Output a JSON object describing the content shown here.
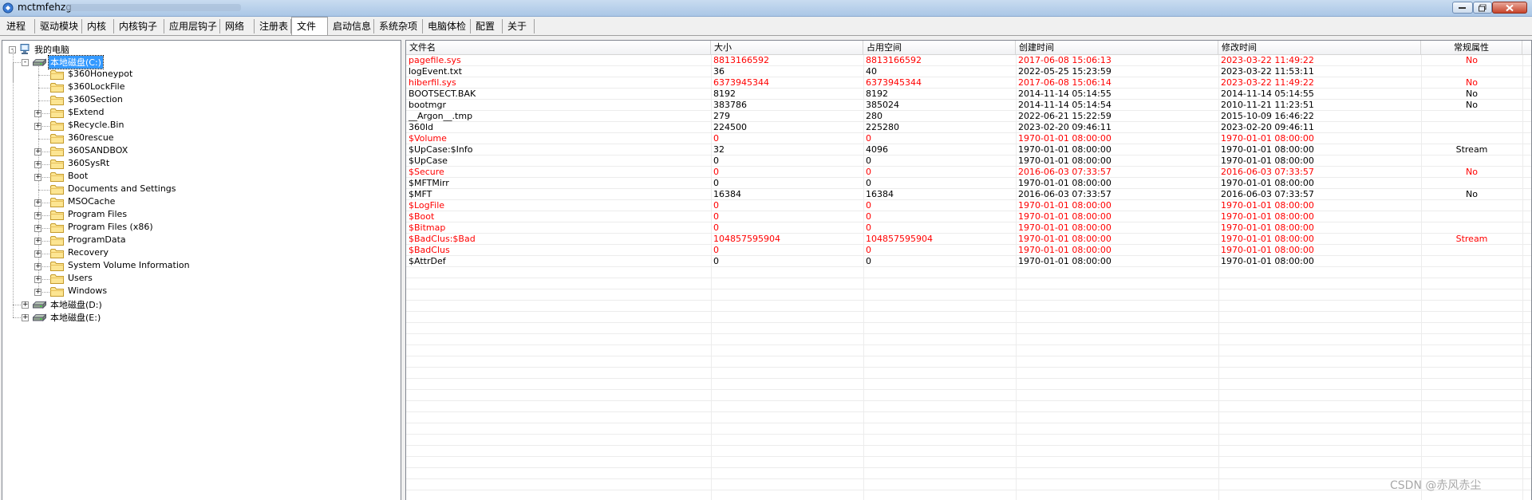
{
  "window": {
    "title": "mctmfehzg"
  },
  "tabs": [
    {
      "label": "进程"
    },
    {
      "label": "驱动模块"
    },
    {
      "label": "内核"
    },
    {
      "label": "内核钩子"
    },
    {
      "label": "应用层钩子"
    },
    {
      "label": "网络"
    },
    {
      "label": "注册表"
    },
    {
      "label": "文件",
      "active": true
    },
    {
      "label": "启动信息"
    },
    {
      "label": "系统杂项"
    },
    {
      "label": "电脑体检"
    },
    {
      "label": "配置"
    },
    {
      "label": "关于"
    }
  ],
  "tree": {
    "root": "我的电脑",
    "drive_c": "本地磁盘(C:)",
    "children": [
      {
        "label": "$360Honeypot",
        "expandable": false
      },
      {
        "label": "$360LockFile",
        "expandable": false
      },
      {
        "label": "$360Section",
        "expandable": false
      },
      {
        "label": "$Extend",
        "expandable": true
      },
      {
        "label": "$Recycle.Bin",
        "expandable": true
      },
      {
        "label": "360rescue",
        "expandable": false
      },
      {
        "label": "360SANDBOX",
        "expandable": true
      },
      {
        "label": "360SysRt",
        "expandable": true
      },
      {
        "label": "Boot",
        "expandable": true
      },
      {
        "label": "Documents and Settings",
        "expandable": false
      },
      {
        "label": "MSOCache",
        "expandable": true
      },
      {
        "label": "Program Files",
        "expandable": true
      },
      {
        "label": "Program Files (x86)",
        "expandable": true
      },
      {
        "label": "ProgramData",
        "expandable": true
      },
      {
        "label": "Recovery",
        "expandable": true
      },
      {
        "label": "System Volume Information",
        "expandable": true
      },
      {
        "label": "Users",
        "expandable": true
      },
      {
        "label": "Windows",
        "expandable": true
      }
    ],
    "other_drives": [
      "本地磁盘(D:)",
      "本地磁盘(E:)"
    ]
  },
  "list": {
    "columns": [
      "文件名",
      "大小",
      "占用空间",
      "创建时间",
      "修改时间",
      "常规属性"
    ],
    "rows": [
      {
        "name": "pagefile.sys",
        "size": "8813166592",
        "alloc": "8813166592",
        "created": "2017-06-08 15:06:13",
        "modified": "2023-03-22 11:49:22",
        "attr": "No",
        "red": true
      },
      {
        "name": "logEvent.txt",
        "size": "36",
        "alloc": "40",
        "created": "2022-05-25 15:23:59",
        "modified": "2023-03-22 11:53:11",
        "attr": "",
        "red": false
      },
      {
        "name": "hiberfil.sys",
        "size": "6373945344",
        "alloc": "6373945344",
        "created": "2017-06-08 15:06:14",
        "modified": "2023-03-22 11:49:22",
        "attr": "No",
        "red": true
      },
      {
        "name": "BOOTSECT.BAK",
        "size": "8192",
        "alloc": "8192",
        "created": "2014-11-14 05:14:55",
        "modified": "2014-11-14 05:14:55",
        "attr": "No",
        "red": false
      },
      {
        "name": "bootmgr",
        "size": "383786",
        "alloc": "385024",
        "created": "2014-11-14 05:14:54",
        "modified": "2010-11-21 11:23:51",
        "attr": "No",
        "red": false
      },
      {
        "name": "__Argon__.tmp",
        "size": "279",
        "alloc": "280",
        "created": "2022-06-21 15:22:59",
        "modified": "2015-10-09 16:46:22",
        "attr": "",
        "red": false
      },
      {
        "name": "360ld",
        "size": "224500",
        "alloc": "225280",
        "created": "2023-02-20 09:46:11",
        "modified": "2023-02-20 09:46:11",
        "attr": "",
        "red": false
      },
      {
        "name": "$Volume",
        "size": "0",
        "alloc": "0",
        "created": "1970-01-01 08:00:00",
        "modified": "1970-01-01 08:00:00",
        "attr": "",
        "red": true
      },
      {
        "name": "$UpCase:$Info",
        "size": "32",
        "alloc": "4096",
        "created": "1970-01-01 08:00:00",
        "modified": "1970-01-01 08:00:00",
        "attr": "Stream",
        "red": false
      },
      {
        "name": "$UpCase",
        "size": "0",
        "alloc": "0",
        "created": "1970-01-01 08:00:00",
        "modified": "1970-01-01 08:00:00",
        "attr": "",
        "red": false
      },
      {
        "name": "$Secure",
        "size": "0",
        "alloc": "0",
        "created": "2016-06-03 07:33:57",
        "modified": "2016-06-03 07:33:57",
        "attr": "No",
        "red": true
      },
      {
        "name": "$MFTMirr",
        "size": "0",
        "alloc": "0",
        "created": "1970-01-01 08:00:00",
        "modified": "1970-01-01 08:00:00",
        "attr": "",
        "red": false
      },
      {
        "name": "$MFT",
        "size": "16384",
        "alloc": "16384",
        "created": "2016-06-03 07:33:57",
        "modified": "2016-06-03 07:33:57",
        "attr": "No",
        "red": false
      },
      {
        "name": "$LogFile",
        "size": "0",
        "alloc": "0",
        "created": "1970-01-01 08:00:00",
        "modified": "1970-01-01 08:00:00",
        "attr": "",
        "red": true
      },
      {
        "name": "$Boot",
        "size": "0",
        "alloc": "0",
        "created": "1970-01-01 08:00:00",
        "modified": "1970-01-01 08:00:00",
        "attr": "",
        "red": true
      },
      {
        "name": "$Bitmap",
        "size": "0",
        "alloc": "0",
        "created": "1970-01-01 08:00:00",
        "modified": "1970-01-01 08:00:00",
        "attr": "",
        "red": true
      },
      {
        "name": "$BadClus:$Bad",
        "size": "104857595904",
        "alloc": "104857595904",
        "created": "1970-01-01 08:00:00",
        "modified": "1970-01-01 08:00:00",
        "attr": "Stream",
        "red": true
      },
      {
        "name": "$BadClus",
        "size": "0",
        "alloc": "0",
        "created": "1970-01-01 08:00:00",
        "modified": "1970-01-01 08:00:00",
        "attr": "",
        "red": true
      },
      {
        "name": "$AttrDef",
        "size": "0",
        "alloc": "0",
        "created": "1970-01-01 08:00:00",
        "modified": "1970-01-01 08:00:00",
        "attr": "",
        "red": false
      }
    ]
  },
  "watermark": "CSDN @赤风赤尘",
  "colors": {
    "alert_red": "#ff0000",
    "selection_blue": "#3399ff"
  }
}
